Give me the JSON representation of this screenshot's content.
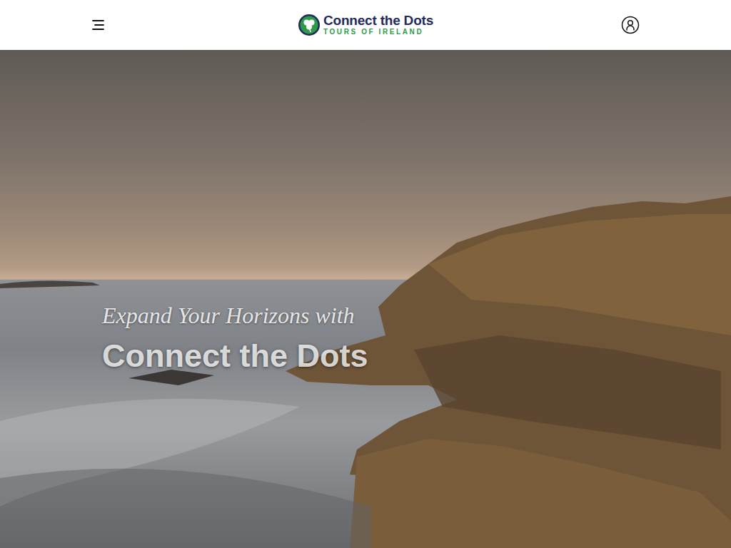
{
  "logo": {
    "title": "Connect the Dots",
    "subtitle": "TOURS OF IRELAND"
  },
  "hero": {
    "tagline": "Expand Your Horizons with",
    "heading": "Connect the Dots"
  }
}
